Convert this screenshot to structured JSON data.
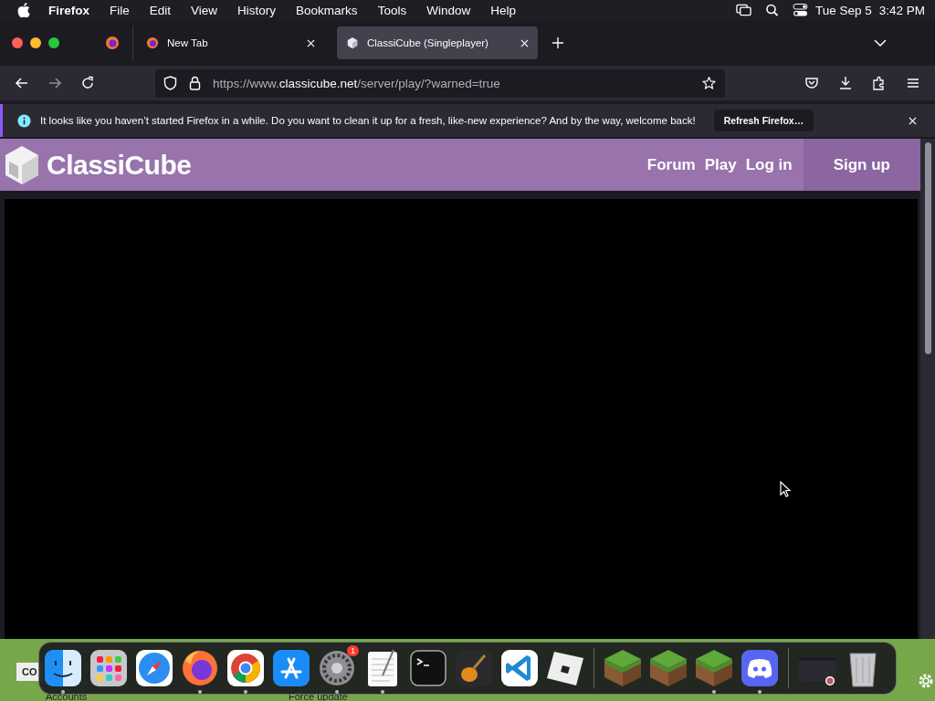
{
  "menu_bar": {
    "app": "Firefox",
    "items": [
      "File",
      "Edit",
      "View",
      "History",
      "Bookmarks",
      "Tools",
      "Window",
      "Help"
    ],
    "date": "Tue Sep 5",
    "time": "3:42 PM"
  },
  "tabs": [
    {
      "title": "New Tab",
      "selected": false,
      "kind": "firefox"
    },
    {
      "title": "ClassiCube (Singleplayer)",
      "selected": true,
      "kind": "cube"
    }
  ],
  "address_bar": {
    "url": "https://www.**classicube.net**/server/play/?warned=true"
  },
  "notification": {
    "message": "It looks like you haven’t started Firefox in a while. Do you want to clean it up for a fresh, like-new experience? And by the way, welcome back!",
    "button": "Refresh Firefox…"
  },
  "site_header": {
    "logo": "ClassiCube",
    "nav": [
      {
        "label": "Forum",
        "kind": "link"
      },
      {
        "label": "Play",
        "kind": "link"
      },
      {
        "label": "Log in",
        "kind": "link"
      },
      {
        "label": "Sign up",
        "kind": "highlight"
      }
    ]
  },
  "desktop": {
    "labels": [
      "CO",
      "Accounts",
      "Force update"
    ]
  },
  "dock": {
    "items": [
      {
        "kind": "finder",
        "running": true
      },
      {
        "kind": "launchpad"
      },
      {
        "kind": "safari"
      },
      {
        "kind": "firefox",
        "running": true
      },
      {
        "kind": "chrome",
        "running": true
      },
      {
        "kind": "appstore"
      },
      {
        "kind": "settings",
        "running": true,
        "badge": "1"
      },
      {
        "kind": "textedit",
        "running": true
      },
      {
        "kind": "terminal"
      },
      {
        "kind": "guitar"
      },
      {
        "kind": "vscode"
      },
      {
        "kind": "roblox"
      },
      {
        "kind": "separator"
      },
      {
        "kind": "grass"
      },
      {
        "kind": "grass"
      },
      {
        "kind": "grass",
        "running": true
      },
      {
        "kind": "discord",
        "running": true
      },
      {
        "kind": "separator"
      },
      {
        "kind": "window"
      },
      {
        "kind": "trash"
      }
    ]
  }
}
